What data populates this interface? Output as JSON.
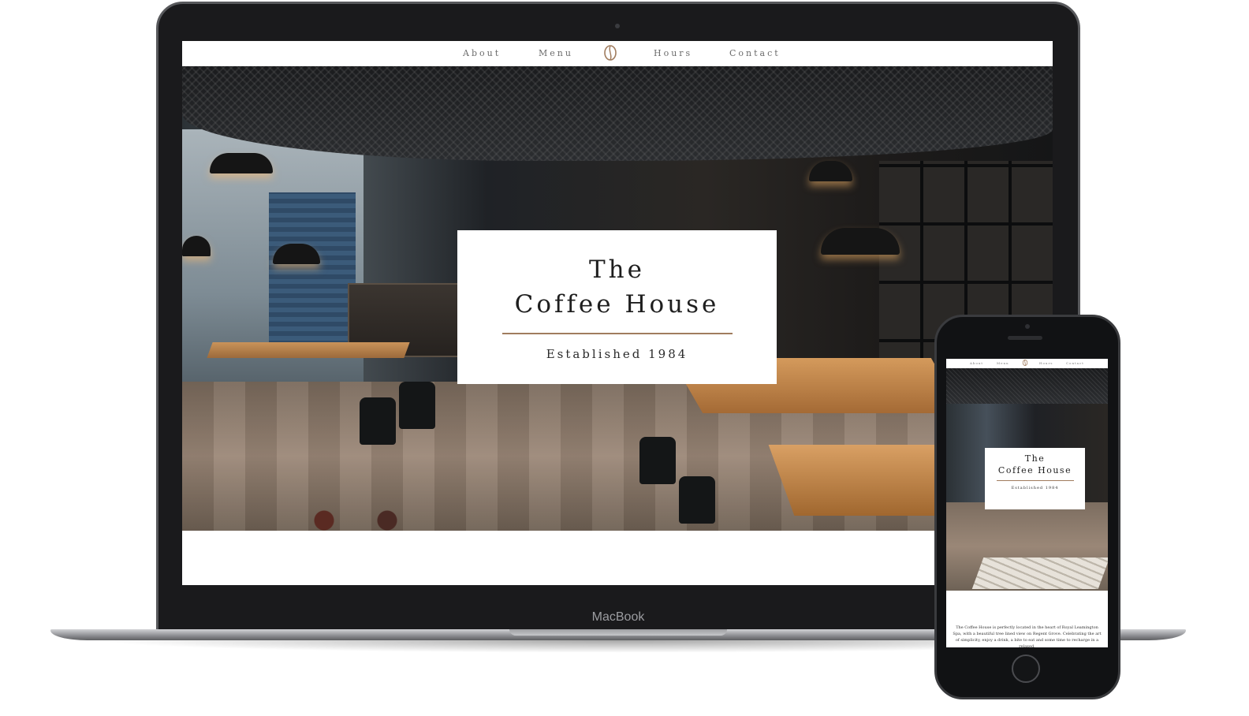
{
  "laptop": {
    "brand_label": "MacBook"
  },
  "site": {
    "nav": {
      "items": [
        "About",
        "Menu",
        "Hours",
        "Contact"
      ]
    },
    "hero": {
      "title_line1": "The",
      "title_line2": "Coffee House",
      "subtitle": "Established 1984"
    },
    "intro_text": "The Coffee House is perfectly located in the heart of Royal Leamington Spa, with a beautiful tree lined view on Regent Grove. Celebrating the art of simplicity, enjoy a drink, a bite to eat and some time to recharge in a relaxed,"
  },
  "icons": {
    "logo": "coffee-bean-icon"
  },
  "colors": {
    "accent": "#a07c5e",
    "device_frame": "#1a1a1c"
  }
}
